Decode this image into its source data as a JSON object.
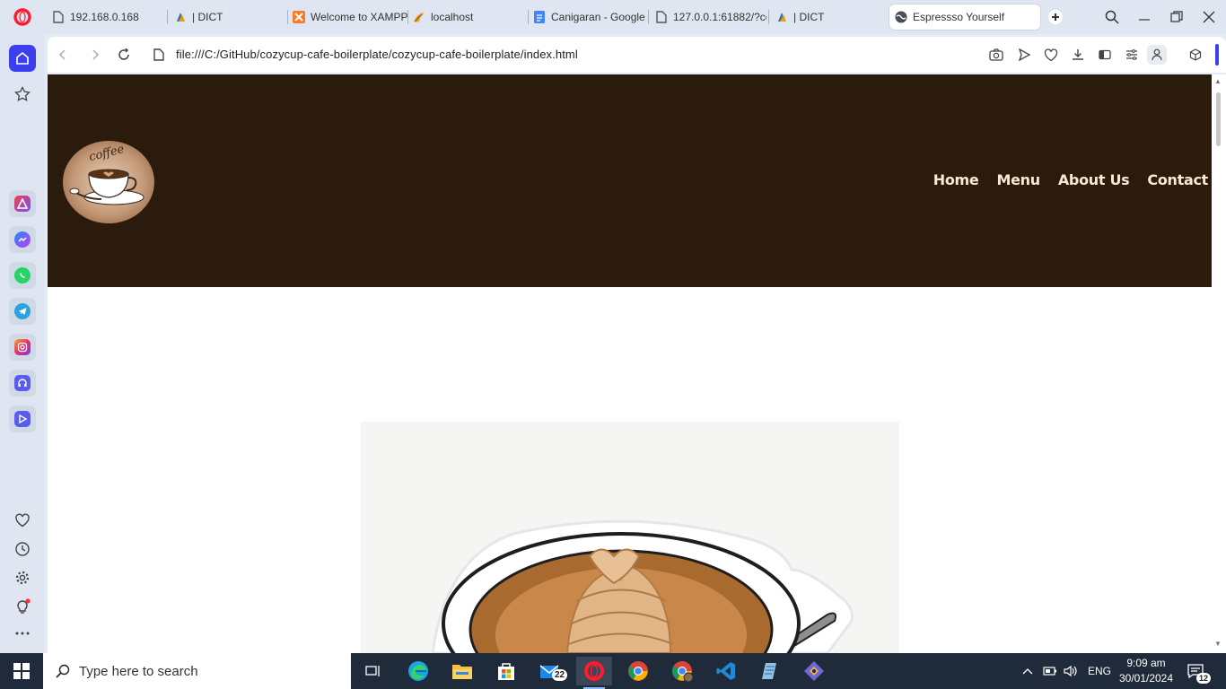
{
  "browser": {
    "tabs": [
      {
        "label": "192.168.0.168",
        "icon": "page-icon"
      },
      {
        "label": "| DICT",
        "icon": "dict-icon"
      },
      {
        "label": "Welcome to XAMPP",
        "icon": "xampp-icon"
      },
      {
        "label": "localhost",
        "icon": "phpmyadmin-icon"
      },
      {
        "label": "Canigaran - Google",
        "icon": "docs-icon"
      },
      {
        "label": "127.0.0.1:61882/?co",
        "icon": "page-icon"
      },
      {
        "label": "| DICT",
        "icon": "dict-icon"
      },
      {
        "label": "Espressso Yourself",
        "icon": "globe-icon",
        "active": true
      }
    ],
    "url": "file:///C:/GitHub/cozycup-cafe-boilerplate/cozycup-cafe-boilerplate/index.html"
  },
  "site": {
    "logo_text": "coffee",
    "nav": [
      "Home",
      "Menu",
      "About Us",
      "Contact"
    ],
    "colors": {
      "header_bg": "#2b1b0c",
      "nav_text": "#fbe7d2"
    }
  },
  "taskbar": {
    "search_placeholder": "Type here to search",
    "mail_badge": "22",
    "language": "ENG",
    "time": "9:09 am",
    "date": "30/01/2024",
    "notifications": "12"
  }
}
